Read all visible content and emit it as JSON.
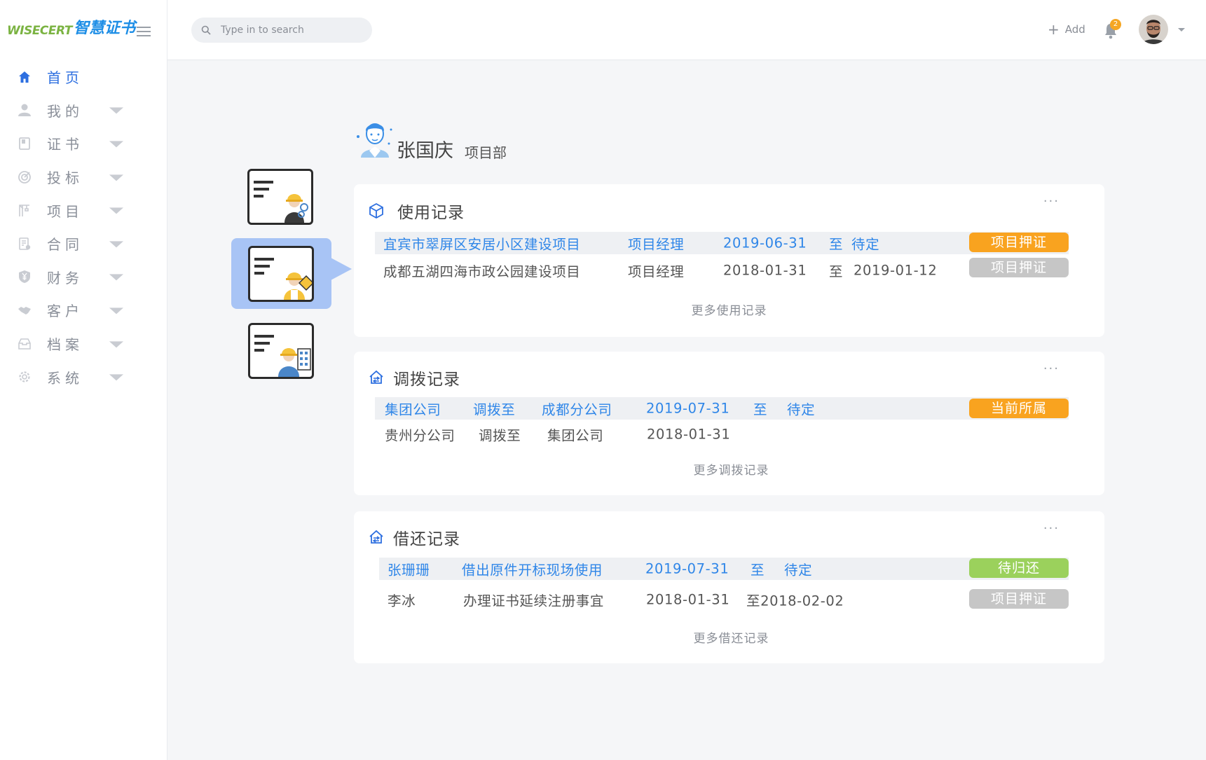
{
  "brand": {
    "logo_en": "WISECERT",
    "logo_cn": "智慧证书"
  },
  "sidebar": {
    "items": [
      {
        "label": "首页",
        "icon": "home-icon",
        "active": true,
        "has_caret": false
      },
      {
        "label": "我的",
        "icon": "user-icon",
        "active": false,
        "has_caret": true
      },
      {
        "label": "证书",
        "icon": "certificate-icon",
        "active": false,
        "has_caret": true
      },
      {
        "label": "投标",
        "icon": "target-icon",
        "active": false,
        "has_caret": true
      },
      {
        "label": "项目",
        "icon": "crane-icon",
        "active": false,
        "has_caret": true
      },
      {
        "label": "合同",
        "icon": "contract-icon",
        "active": false,
        "has_caret": true
      },
      {
        "label": "财务",
        "icon": "yen-shield-icon",
        "active": false,
        "has_caret": true
      },
      {
        "label": "客户",
        "icon": "handshake-icon",
        "active": false,
        "has_caret": true
      },
      {
        "label": "档案",
        "icon": "archive-icon",
        "active": false,
        "has_caret": true
      },
      {
        "label": "系统",
        "icon": "gear-icon",
        "active": false,
        "has_caret": true
      }
    ]
  },
  "header": {
    "search_placeholder": "Type in to search",
    "add_label": "Add",
    "notification_count": "2"
  },
  "person": {
    "name": "张国庆",
    "dept": "项目部"
  },
  "cards": {
    "usage": {
      "title": "使用记录",
      "more": "更多使用记录",
      "rows": [
        {
          "project": "宜宾市翠屏区安居小区建设项目",
          "role": "项目经理",
          "start": "2019-06-31",
          "sep": "至",
          "end": "待定",
          "badge": "项目押证",
          "badge_color": "#f9a31f"
        },
        {
          "project": "成都五湖四海市政公园建设项目",
          "role": "项目经理",
          "start": "2018-01-31",
          "sep": "至",
          "end": "2019-01-12",
          "badge": "项目押证",
          "badge_color": "#c6c6c6"
        }
      ]
    },
    "transfer": {
      "title": "调拨记录",
      "more": "更多调拨记录",
      "rows": [
        {
          "from": "集团公司",
          "action": "调拨至",
          "to": "成都分公司",
          "date": "2019-07-31",
          "sep": "至",
          "end": "待定",
          "badge": "当前所属",
          "badge_color": "#f9a31f"
        },
        {
          "from": "贵州分公司",
          "action": "调拨至",
          "to": "集团公司",
          "date": "2018-01-31",
          "sep": "",
          "end": ""
        }
      ]
    },
    "borrow": {
      "title": "借还记录",
      "more": "更多借还记录",
      "rows": [
        {
          "person": "张珊珊",
          "purpose": "借出原件开标现场使用",
          "start": "2019-07-31",
          "sep": "至",
          "end": "待定",
          "badge": "待归还",
          "badge_color": "#9bd15c"
        },
        {
          "person": "李冰",
          "purpose": "办理证书延续注册事宜",
          "start": "2018-01-31",
          "sep_end": "至2018-02-02",
          "badge": "项目押证",
          "badge_color": "#c6c6c6"
        }
      ]
    }
  },
  "colors": {
    "accent": "#2d6fe0",
    "link": "#2f86e8",
    "orange": "#f9a31f",
    "green": "#9bd15c",
    "gray": "#c6c6c6"
  }
}
